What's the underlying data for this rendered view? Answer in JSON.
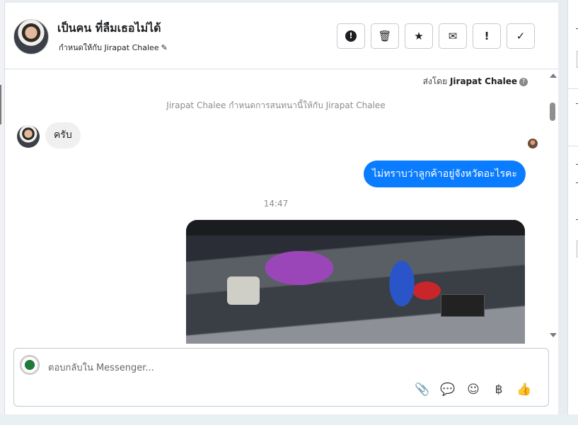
{
  "conversation": {
    "title": "เป็นคน ที่ลืมเธอไม่ได้",
    "assigned_text": "กำหนดให้กับ Jirapat Chalee"
  },
  "header_actions": [
    {
      "name": "report-button",
      "icon": "!"
    },
    {
      "name": "delete-button",
      "icon": "🗑"
    },
    {
      "name": "star-button",
      "icon": "★"
    },
    {
      "name": "mark-unread-button",
      "icon": "✉"
    },
    {
      "name": "flag-button",
      "icon": "!"
    },
    {
      "name": "done-button",
      "icon": "✓"
    }
  ],
  "thread": {
    "sent_by_prefix": "ส่งโดย",
    "sent_by_name": "Jirapat Chalee",
    "system_message": "Jirapat Chalee กำหนดการสนทนานี้ให้กับ Jirapat Chalee",
    "incoming_message": "ครับ",
    "outgoing_message": "ไม่ทราบว่าลูกค้าอยู่จังหวัดอะไรคะ",
    "timestamp": "14:47"
  },
  "composer": {
    "placeholder": "ตอบกลับใน Messenger..."
  },
  "composer_tools": [
    {
      "name": "attach-icon",
      "icon": "📎"
    },
    {
      "name": "saved-replies-icon",
      "icon": "💬"
    },
    {
      "name": "emoji-icon",
      "icon": "☺"
    },
    {
      "name": "baht-icon",
      "icon": "฿"
    },
    {
      "name": "like-icon",
      "icon": "👍"
    }
  ],
  "colors": {
    "accent": "#0a7cff",
    "incoming_bubble": "#f0f0f0"
  }
}
